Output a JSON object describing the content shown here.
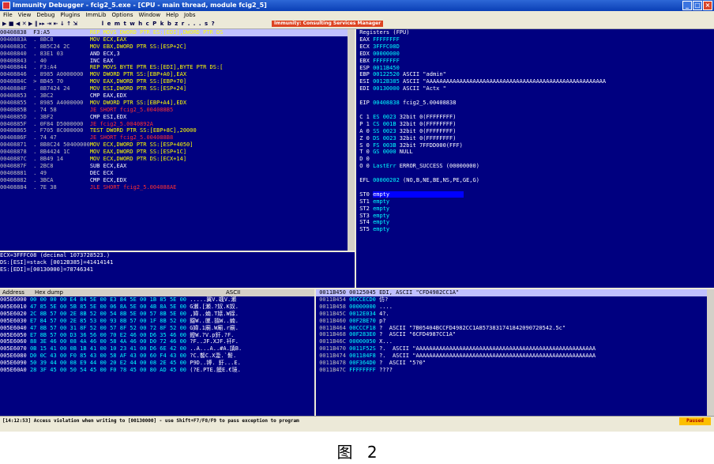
{
  "window": {
    "title": "Immunity Debugger - fcig2_5.exe - [CPU - main thread, module fcig2_5]"
  },
  "menu": [
    "File",
    "View",
    "Debug",
    "Plugins",
    "ImmLib",
    "Options",
    "Window",
    "Help",
    "Jobs"
  ],
  "toolbar": {
    "buttons": "▶ ■ ◀ ✕ ▶ ‖ ▸▸ ⇥ ⇤ ↓ ↑ ⇲",
    "letters": "l e m t w h c P k b z r . . . s ?",
    "badge": "Immunity: Consulting Services Manager"
  },
  "disasm": {
    "rows": [
      [
        "00408838",
        "F3:A5",
        "REP MOVS DWORD PTR ES:[EDI],DWORD PTR DS"
      ],
      [
        "0040883A",
        ". 8BC8",
        "MOV ECX,EAX"
      ],
      [
        "0040883C",
        ". 8B5C24 2C",
        "MOV EBX,DWORD PTR SS:[ESP+2C]"
      ],
      [
        "00408840",
        ". 83E1 03",
        "AND ECX,3"
      ],
      [
        "00408843",
        ". 40",
        "INC EAX"
      ],
      [
        "00408844",
        ". F3:A4",
        "REP MOVS BYTE PTR ES:[EDI],BYTE PTR DS:["
      ],
      [
        "00408846",
        ". 8985 A0000000",
        "MOV DWORD PTR SS:[EBP+A0],EAX"
      ],
      [
        "0040884C",
        "> 8B45 70",
        "MOV EAX,DWORD PTR SS:[EBP+70]"
      ],
      [
        "0040884F",
        ". 8B7424 24",
        "MOV ESI,DWORD PTR SS:[ESP+24]"
      ],
      [
        "00408853",
        ". 3BC2",
        "CMP EAX,EDX"
      ],
      [
        "00408855",
        ". 8985 A4000000",
        "MOV DWORD PTR SS:[EBP+A4],EDX"
      ],
      [
        "0040885B",
        ". 74 58",
        "JE SHORT fcig2_5.004088B5"
      ],
      [
        "0040885D",
        ". 3BF2",
        "CMP ESI,EDX"
      ],
      [
        "0040885F",
        ". 0F84 D5000000",
        "JE fcig2_5.0040892A"
      ],
      [
        "00408865",
        ". F705 8C000000",
        "TEST DWORD PTR SS:[EBP+8C],20000"
      ],
      [
        "0040886F",
        ". 74 47",
        "JE SHORT fcig2_5.004088B8"
      ],
      [
        "00408871",
        ". 8B8C24 50400000",
        "MOV ECX,DWORD PTR SS:[ESP+4050]"
      ],
      [
        "00408878",
        ". 8B4424 1C",
        "MOV EAX,DWORD PTR SS:[ESP+1C]"
      ],
      [
        "0040887C",
        ". 8B49 14",
        "MOV ECX,DWORD PTR DS:[ECX+14]"
      ],
      [
        "0040887F",
        ". 2BC8",
        "SUB ECX,EAX"
      ],
      [
        "00408881",
        ". 49",
        "DEC ECX"
      ],
      [
        "00408882",
        ". 3BCA",
        "CMP ECX,EDX"
      ],
      [
        "00408884",
        ". 7E 38",
        "JLE SHORT fcig2_5.004088AE"
      ]
    ],
    "info": [
      "ECX=3FFFC08 (decimal 1073728523.)",
      "DS:[ESI]=stack [0012B385]=41414141",
      "ES:[EDI]=[00130000]=78746341"
    ]
  },
  "registers": {
    "header": "Registers (FPU)",
    "lines": [
      [
        "EAX",
        "FFFFFFFF",
        ""
      ],
      [
        "ECX",
        "3FFFC08D",
        ""
      ],
      [
        "EDX",
        "00000000",
        ""
      ],
      [
        "EBX",
        "FFFFFFFF",
        ""
      ],
      [
        "ESP",
        "0011B450",
        ""
      ],
      [
        "EBP",
        "00122520",
        "ASCII \"admin\""
      ],
      [
        "ESI",
        "0012B385",
        "ASCII \"AAAAAAAAAAAAAAAAAAAAAAAAAAAAAAAAAAAAAAAAAAAAAAAAAAAAAA"
      ],
      [
        "EDI",
        "00130000",
        "ASCII \"Actx \""
      ],
      [
        "",
        "",
        " "
      ],
      [
        "EIP",
        "00408838",
        "fcig2_5.00408838"
      ],
      [
        "",
        "",
        " "
      ],
      [
        "C 1",
        "ES 0023",
        "32bit 0(FFFFFFFF)"
      ],
      [
        "P 1",
        "CS 001B",
        "32bit 0(FFFFFFFF)"
      ],
      [
        "A 0",
        "SS 0023",
        "32bit 0(FFFFFFFF)"
      ],
      [
        "Z 0",
        "DS 0023",
        "32bit 0(FFFFFFFF)"
      ],
      [
        "S 0",
        "FS 003B",
        "32bit 7FFDD000(FFF)"
      ],
      [
        "T 0",
        "GS 0000",
        "NULL"
      ],
      [
        "D 0",
        "",
        ""
      ],
      [
        "O 0",
        "LastErr",
        "ERROR_SUCCESS (00000000)"
      ],
      [
        "",
        "",
        " "
      ],
      [
        "EFL",
        "00000202",
        "(NO,B,NE,BE,NS,PE,GE,G)"
      ],
      [
        "",
        "",
        " "
      ],
      [
        "ST0",
        "empty",
        ""
      ],
      [
        "ST1",
        "empty",
        ""
      ],
      [
        "ST2",
        "empty",
        ""
      ],
      [
        "ST3",
        "empty",
        ""
      ],
      [
        "ST4",
        "empty",
        ""
      ],
      [
        "ST5",
        "empty",
        ""
      ]
    ]
  },
  "dump": {
    "col_address": "Address",
    "col_hex": "Hex dump",
    "col_ascii": "ASCII",
    "rows": [
      [
        "005E6000",
        "00 00 00 00 E4 84 5E 00 E3 84 5E 00 1B 85 5E 00",
        ".....翼V.颯V.瀬"
      ],
      [
        "005E6010",
        "47 85 5E 00 5B 85 5E 00 06 8A 5E 00 4B 8A 5E 00",
        "G瀬.[瀬.?奴.K奴."
      ],
      [
        "005E6020",
        "2C 8B 57 00 2E 8B 52 00 54 8B 5E 00 57 8B 5E 00",
        ",媁..婻.T媇.W媇."
      ],
      [
        "005E6030",
        "E7 84 57 00 2E 85 53 00 93 8B 57 00 1F 8B 52 00",
        "鐚W..匰.搵W..婻."
      ],
      [
        "005E6040",
        "47 8B 57 00 31 8F 52 00 57 8F 52 00 72 8F 52 00",
        "G媁.1廟.W廟.r廟."
      ],
      [
        "005E6050",
        "E7 8B 57 00 D3 36 56 00 70 E2 46 00 D6 35 46 00",
        "鐙W.?V.p釬.?F."
      ],
      [
        "005E6060",
        "88 3E 46 00 08 4A 46 00 58 4A 46 00 D0 72 46 00",
        "?F..JF.XJF.衦F."
      ],
      [
        "005E6070",
        "0B 15 41 00 0B 1B 41 00 10 23 41 00 D6 6E 42 00",
        "..A...A..#A.謓B."
      ],
      [
        "005E6080",
        "D0 0C 43 00 F0 85 43 00 58 AF 43 00 60 F4 43 00",
        "?C.饏C.X疌.`鬋."
      ],
      [
        "005E6090",
        "50 39 44 00 08 E9 44 00 20 E2 44 00 08 2E 45 00",
        "P9D..镈. 釪...E."
      ],
      [
        "005E60A0",
        "28 3F 45 00 50 54 45 00 F0 78 45 00 80 AD 45 00",
        "(?E.PTE.饃E.€璄."
      ]
    ]
  },
  "stack": {
    "rows": [
      [
        "0011B450",
        "00125045",
        "EDI, ASCII \"CFD4982CC1A\""
      ],
      [
        "0011B454",
        "00CCECD0",
        "仿?"
      ],
      [
        "0011B458",
        "00000000",
        "...."
      ],
      [
        "0011B45C",
        "0012E034",
        "4?."
      ],
      [
        "0011B460",
        "00F2BE70",
        "p?"
      ],
      [
        "0011B464",
        "00CCCF18",
        "?  ASCII \"7B05404BCCFD4982CC1A8573831741842090720542.5c\""
      ],
      [
        "0011B468",
        "00F283E0",
        "?  ASCII \"6CFD4987CC1A\""
      ],
      [
        "0011B46C",
        "00000050",
        "X..."
      ],
      [
        "0011B470",
        "0011F52S",
        "?.  ASCII \"AAAAAAAAAAAAAAAAAAAAAAAAAAAAAAAAAAAAAAAAAAAAAAAAAAAAAA"
      ],
      [
        "0011B474",
        "001184F8",
        "?.  ASCII \"AAAAAAAAAAAAAAAAAAAAAAAAAAAAAAAAAAAAAAAAAAAAAAAAAAAAAA"
      ],
      [
        "0011B478",
        "00F364D0",
        "?  ASCII \"5?0\""
      ],
      [
        "0011B47C",
        "FFFFFFFF",
        "????"
      ]
    ]
  },
  "statusbar": {
    "text": "[14:12:53] Access violation when writing to [00130000] - use Shift+F7/F8/F9 to pass exception to program",
    "state": "Paused"
  },
  "caption": {
    "label": "图",
    "number": "2"
  }
}
